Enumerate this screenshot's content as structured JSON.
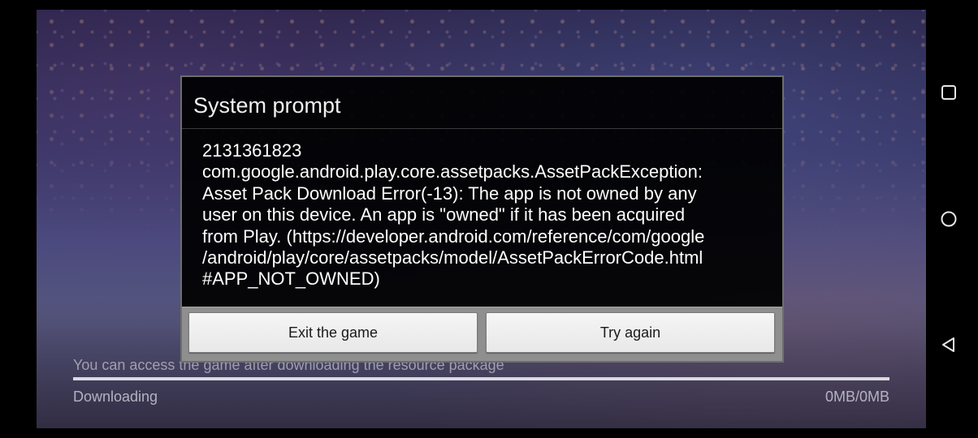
{
  "game": {
    "load_hint": "You can access the game after downloading the resource package",
    "download_status": "Downloading",
    "download_size": "0MB/0MB",
    "progress_fraction": 1.0
  },
  "dialog": {
    "title": "System prompt",
    "message_lines": [
      "2131361823",
      "com.google.android.play.core.assetpacks.AssetPackException:",
      "Asset Pack Download Error(-13): The app is not owned by any",
      "user on this device. An app is \"owned\" if it has been acquired",
      "from Play. (https://developer.android.com/reference/com/google",
      "/android/play/core/assetpacks/model/AssetPackErrorCode.html",
      "#APP_NOT_OWNED)"
    ],
    "buttons": {
      "exit_label": "Exit the game",
      "retry_label": "Try again"
    }
  },
  "nav_bar": {
    "icons": [
      "recent-apps-icon",
      "home-icon",
      "back-icon"
    ],
    "icon_color": "#e6e6e6"
  }
}
